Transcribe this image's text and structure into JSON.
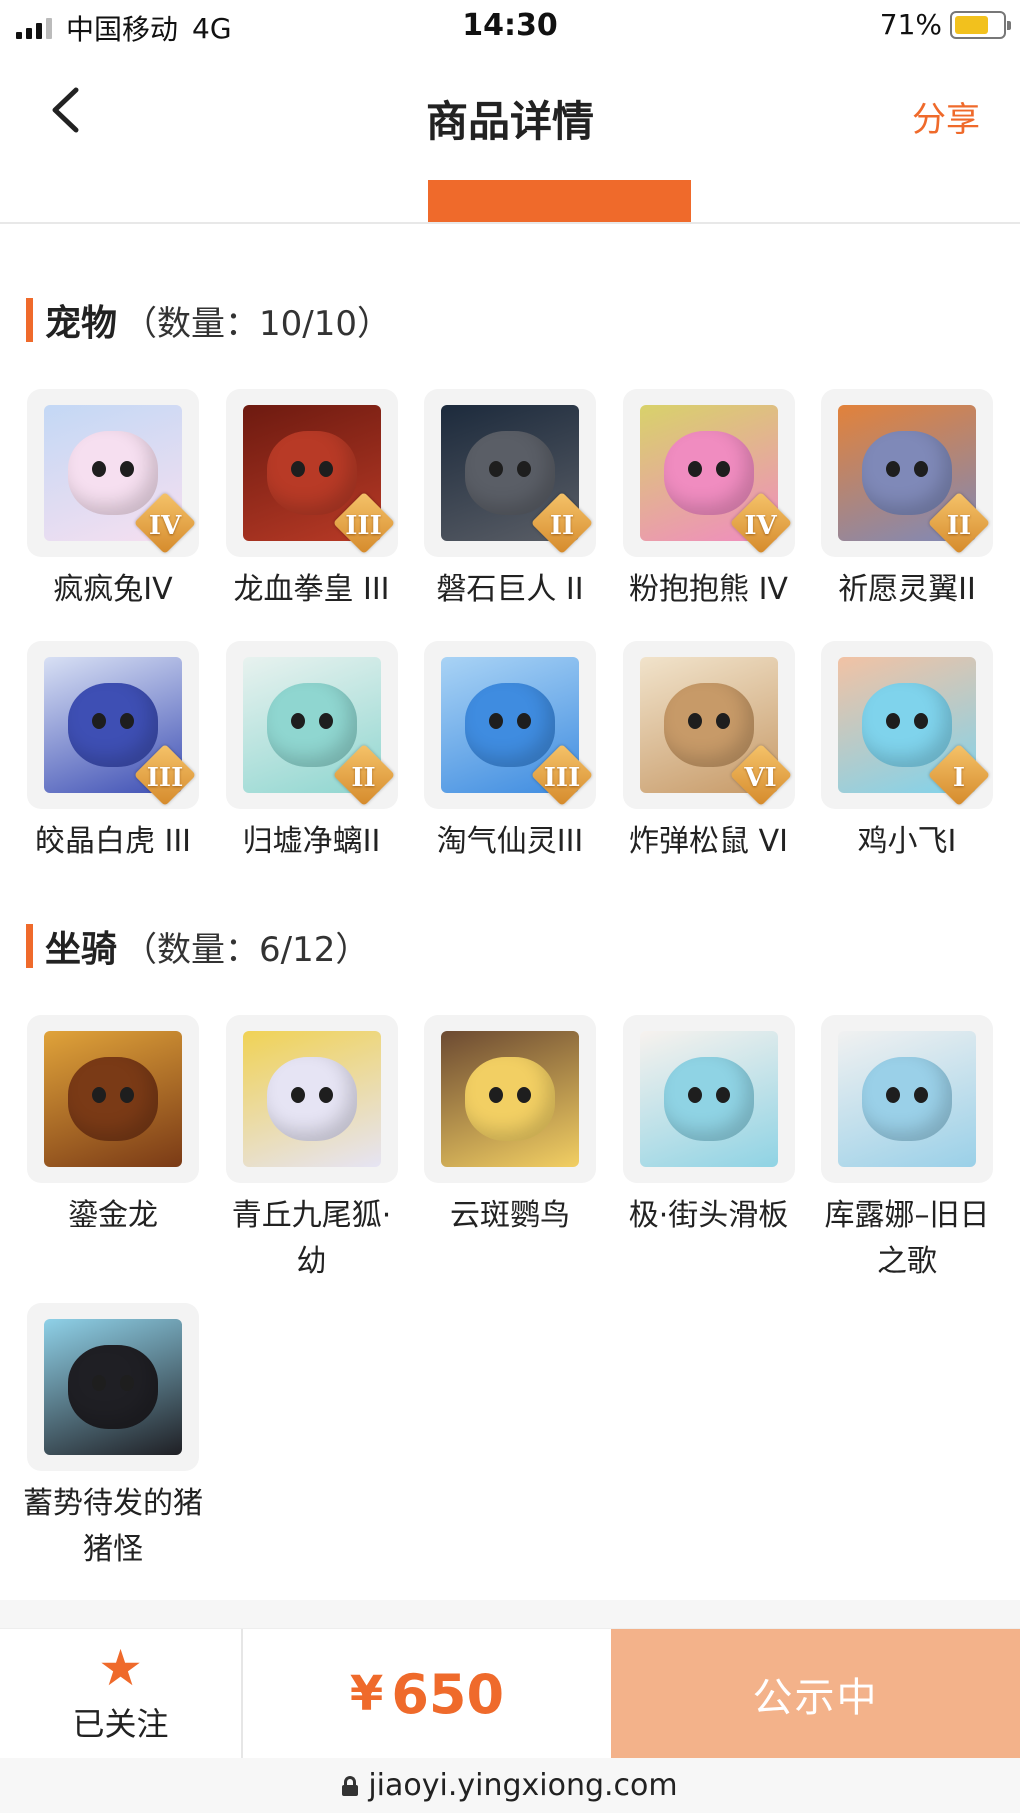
{
  "status_bar": {
    "carrier": "中国移动",
    "network": "4G",
    "time": "14:30",
    "battery": "71%",
    "battery_level": 0.71
  },
  "nav": {
    "title": "商品详情",
    "share": "分享"
  },
  "pets": {
    "name": "宠物",
    "count": "（数量：10/10）",
    "items": [
      {
        "name": "疯疯兔IV",
        "grade": "IV",
        "icon": "pink-rabbit-icon",
        "colors": [
          "#f6dff0",
          "#c3d8f5"
        ]
      },
      {
        "name": "龙血拳皇 III",
        "grade": "III",
        "icon": "red-horned-beast-icon",
        "colors": [
          "#b83a26",
          "#6d1a10"
        ]
      },
      {
        "name": "磐石巨人 II",
        "grade": "II",
        "icon": "stone-golem-icon",
        "colors": [
          "#5a5e66",
          "#1c2a3c"
        ]
      },
      {
        "name": "粉抱抱熊 IV",
        "grade": "IV",
        "icon": "pink-bear-icon",
        "colors": [
          "#f08cc0",
          "#d8d26a"
        ]
      },
      {
        "name": "祈愿灵翼II",
        "grade": "II",
        "icon": "griffin-icon",
        "colors": [
          "#7f89b8",
          "#e2823a"
        ]
      },
      {
        "name": "皎晶白虎 III",
        "grade": "III",
        "icon": "white-tiger-icon",
        "colors": [
          "#3e4fb4",
          "#d8e0f4"
        ]
      },
      {
        "name": "归墟净螭II",
        "grade": "II",
        "icon": "jade-dragon-icon",
        "colors": [
          "#8fd6d0",
          "#e8f2ef"
        ]
      },
      {
        "name": "淘气仙灵III",
        "grade": "III",
        "icon": "blue-dog-icon",
        "colors": [
          "#3f8ce0",
          "#a9d3f5"
        ]
      },
      {
        "name": "炸弹松鼠 VI",
        "grade": "VI",
        "icon": "squirrel-icon",
        "colors": [
          "#c79a68",
          "#f1e3cb"
        ]
      },
      {
        "name": "鸡小飞I",
        "grade": "I",
        "icon": "bird-head-muscle-icon",
        "colors": [
          "#7fd3ec",
          "#f2c2a4"
        ]
      }
    ]
  },
  "mounts": {
    "name": "坐骑",
    "count": "（数量：6/12）",
    "items": [
      {
        "name": "鎏金龙",
        "icon": "golden-dragon-icon",
        "colors": [
          "#7a3a16",
          "#e0a33a"
        ]
      },
      {
        "name": "青丘九尾狐·幼",
        "icon": "nine-tail-fox-icon",
        "colors": [
          "#e6e4f4",
          "#f0d255"
        ]
      },
      {
        "name": "云斑鹦鸟",
        "icon": "parrot-icon",
        "colors": [
          "#f2cf63",
          "#6c4a32"
        ]
      },
      {
        "name": "极·街头滑板",
        "icon": "skateboard-icon",
        "colors": [
          "#8fd3e4",
          "#f7f2ee"
        ]
      },
      {
        "name": "库露娜–旧日之歌",
        "icon": "cloud-girl-icon",
        "colors": [
          "#9ad0e8",
          "#f1f1f1"
        ]
      },
      {
        "name": "蓄势待发的猪猪怪",
        "icon": "black-pig-icon",
        "colors": [
          "#1f1f24",
          "#8fd1e8"
        ]
      }
    ]
  },
  "bottom_bar": {
    "follow_label": "已关注",
    "price_symbol": "¥",
    "price": "650",
    "status_button": "公示中"
  },
  "url": "jiaoyi.yingxiong.com",
  "accent_color": "#ef6a2b"
}
